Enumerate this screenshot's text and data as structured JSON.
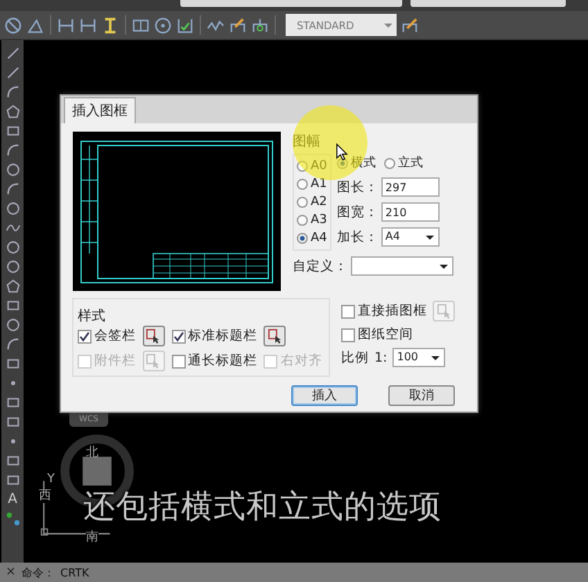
{
  "toolbar": {
    "style_dropdown": "STANDARD"
  },
  "left_toolbar": {
    "text_tool": "A"
  },
  "dialog": {
    "tab": "插入图框",
    "size_group": {
      "title": "图幅",
      "sizes": [
        {
          "label": "A0",
          "selected": false
        },
        {
          "label": "A1",
          "selected": false
        },
        {
          "label": "A2",
          "selected": false
        },
        {
          "label": "A3",
          "selected": false
        },
        {
          "label": "A4",
          "selected": true
        }
      ],
      "orientations": [
        {
          "label": "横式",
          "selected": true
        },
        {
          "label": "立式",
          "selected": false
        }
      ],
      "fields": [
        {
          "kind": "input",
          "label": "图长：",
          "value": "297"
        },
        {
          "kind": "input",
          "label": "图宽：",
          "value": "210"
        },
        {
          "kind": "select",
          "label": "加长：",
          "value": "A4"
        }
      ],
      "custom": {
        "label": "自定义："
      }
    },
    "style_group": {
      "title": "样式",
      "items": [
        {
          "kind": "checkbox",
          "label": "会签栏",
          "checked": true,
          "disabled": false
        },
        {
          "kind": "picker",
          "disabled": false
        },
        {
          "kind": "checkbox",
          "label": "标准标题栏",
          "checked": true,
          "disabled": false
        },
        {
          "kind": "picker",
          "disabled": false
        },
        {
          "kind": "checkbox",
          "label": "附件栏",
          "checked": false,
          "disabled": true
        },
        {
          "kind": "picker",
          "disabled": true
        },
        {
          "kind": "checkbox",
          "label": "通长标题栏",
          "checked": false,
          "disabled": false
        },
        {
          "kind": "checkbox",
          "label": "右对齐",
          "checked": false,
          "disabled": true
        }
      ]
    },
    "options": [
      {
        "label": "直接插图框",
        "checked": false,
        "picker": true
      },
      {
        "label": "图纸空间",
        "checked": false,
        "picker": false
      }
    ],
    "scale": {
      "label": "比例",
      "ratio": "1:",
      "value": "100"
    },
    "buttons": [
      {
        "label": "插入",
        "default": true
      },
      {
        "label": "取消",
        "default": false
      }
    ]
  },
  "viewcube": {
    "tab": "WCS",
    "north": "北",
    "south": "南",
    "west": "西",
    "axis": "Y"
  },
  "subtitle": "还包括横式和立式的选项",
  "command_line": {
    "close": "×",
    "prompt": "命令：",
    "value": "CRTK"
  }
}
